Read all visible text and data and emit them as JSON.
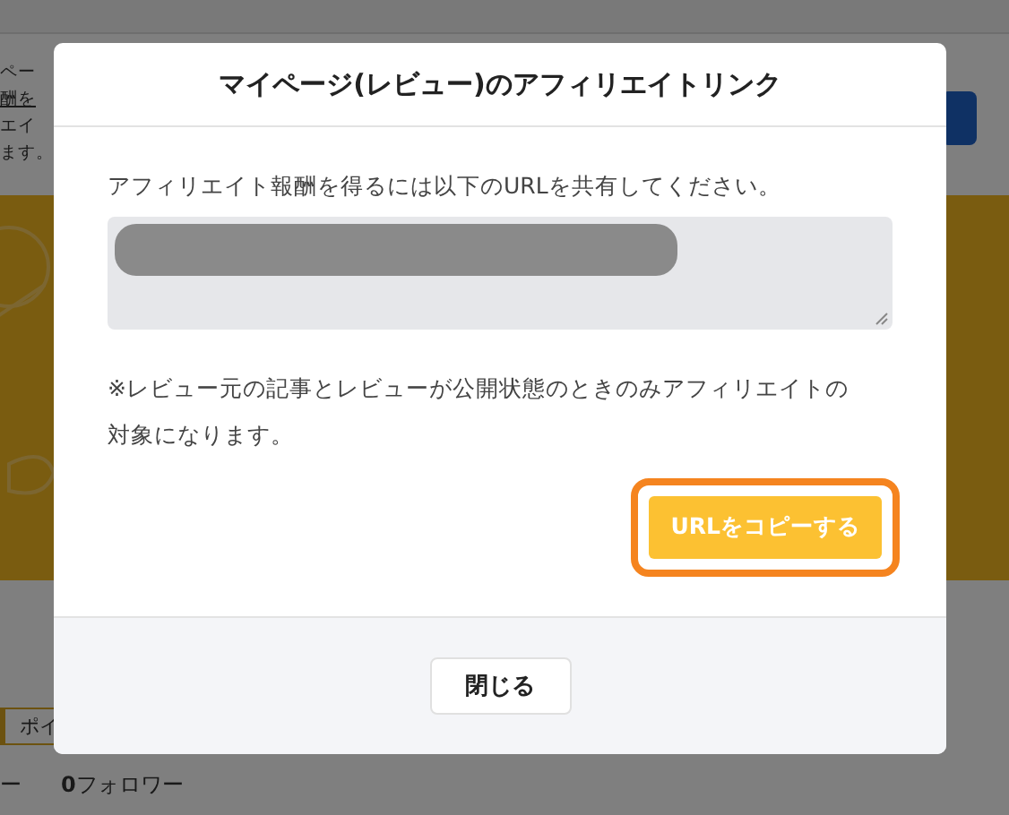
{
  "background_page": {
    "texts": [
      "ペー",
      "酬を",
      "エイ",
      "ます。"
    ],
    "chip": "ポイ",
    "stats": [
      {
        "label": "ー"
      },
      {
        "count": "0",
        "label": "フォロワー"
      }
    ]
  },
  "dialog": {
    "title": "マイページ(レビュー)のアフィリエイトリンク",
    "instruction": "アフィリエイト報酬を得るには以下のURLを共有してください。",
    "url_field": {
      "redacted": true
    },
    "note": "※レビュー元の記事とレビューが公開状態のときのみアフィリエイトの対象になります。",
    "copy_button": {
      "label": "URLをコピーする",
      "highlighted": true
    },
    "close_button": "閉じる"
  }
}
